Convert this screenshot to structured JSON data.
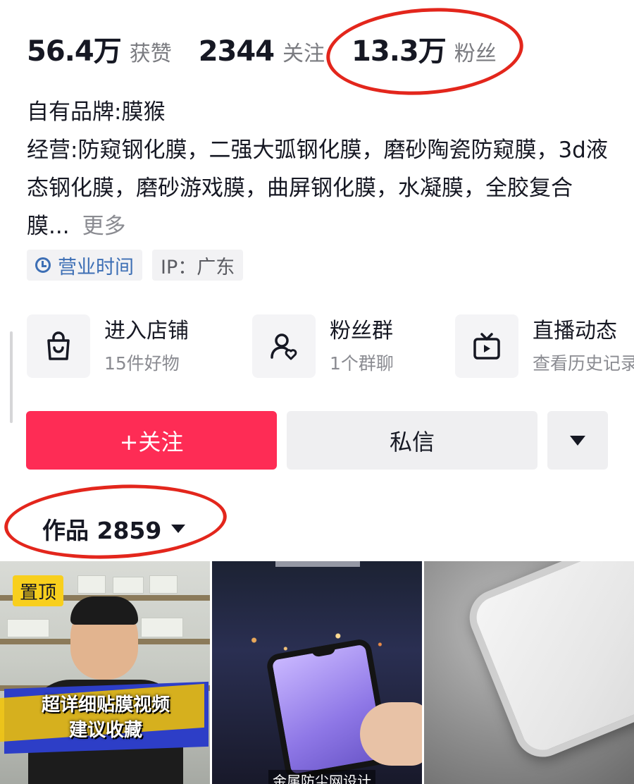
{
  "stats": [
    {
      "value": "56.4万",
      "label": "获赞"
    },
    {
      "value": "2344",
      "label": "关注"
    },
    {
      "value": "13.3万",
      "label": "粉丝"
    }
  ],
  "bio": {
    "line1": "自有品牌:膜猴",
    "line2": "经营:防窥钢化膜，二强大弧钢化膜，磨砂陶瓷防窥膜，3d液态钢化膜，磨砂游戏膜，曲屏钢化膜，水凝膜，全胶复合膜...",
    "more": "更多"
  },
  "tags": {
    "hours": "营业时间",
    "ip": "IP：广东"
  },
  "entries": [
    {
      "title": "进入店铺",
      "sub": "15件好物",
      "icon": "shopping-bag-icon"
    },
    {
      "title": "粉丝群",
      "sub": "1个群聊",
      "icon": "fan-group-icon"
    },
    {
      "title": "直播动态",
      "sub": "查看历史记录",
      "icon": "live-tv-icon"
    }
  ],
  "actions": {
    "follow": "+关注",
    "message": "私信"
  },
  "works": {
    "label": "作品 2859"
  },
  "thumbs": {
    "pinned": "置顶",
    "caption_line1": "超详细贴膜视频",
    "caption_line2": "建议收藏",
    "thumb2_bottom": "金属防尘网设计"
  },
  "colors": {
    "accent": "#fe2c55",
    "annotation": "#e3261c",
    "link": "#3d6fb5"
  }
}
